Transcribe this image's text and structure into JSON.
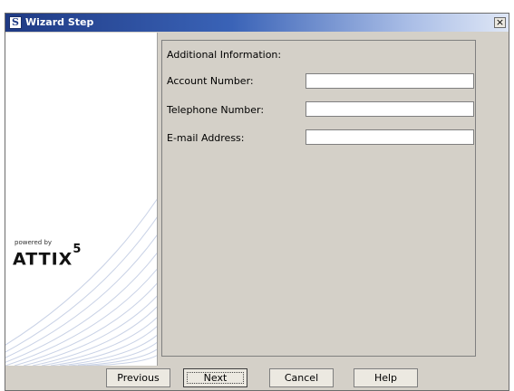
{
  "window": {
    "title": "Wizard Step",
    "app_icon": "S",
    "close_label": "×",
    "close_icon": "close-icon"
  },
  "branding": {
    "powered_by": "powered by",
    "brand_name": "ATTIX",
    "brand_version": "5"
  },
  "form": {
    "section_title": "Additional Information:",
    "fields": [
      {
        "label": "Account Number:",
        "value": ""
      },
      {
        "label": "Telephone Number:",
        "value": ""
      },
      {
        "label": "E-mail Address:",
        "value": ""
      }
    ]
  },
  "buttons": {
    "previous": "Previous",
    "next": "Next",
    "cancel": "Cancel",
    "help": "Help"
  },
  "colors": {
    "title_gradient_start": "#1f3a84",
    "dialog_background": "#d4d0c8"
  }
}
